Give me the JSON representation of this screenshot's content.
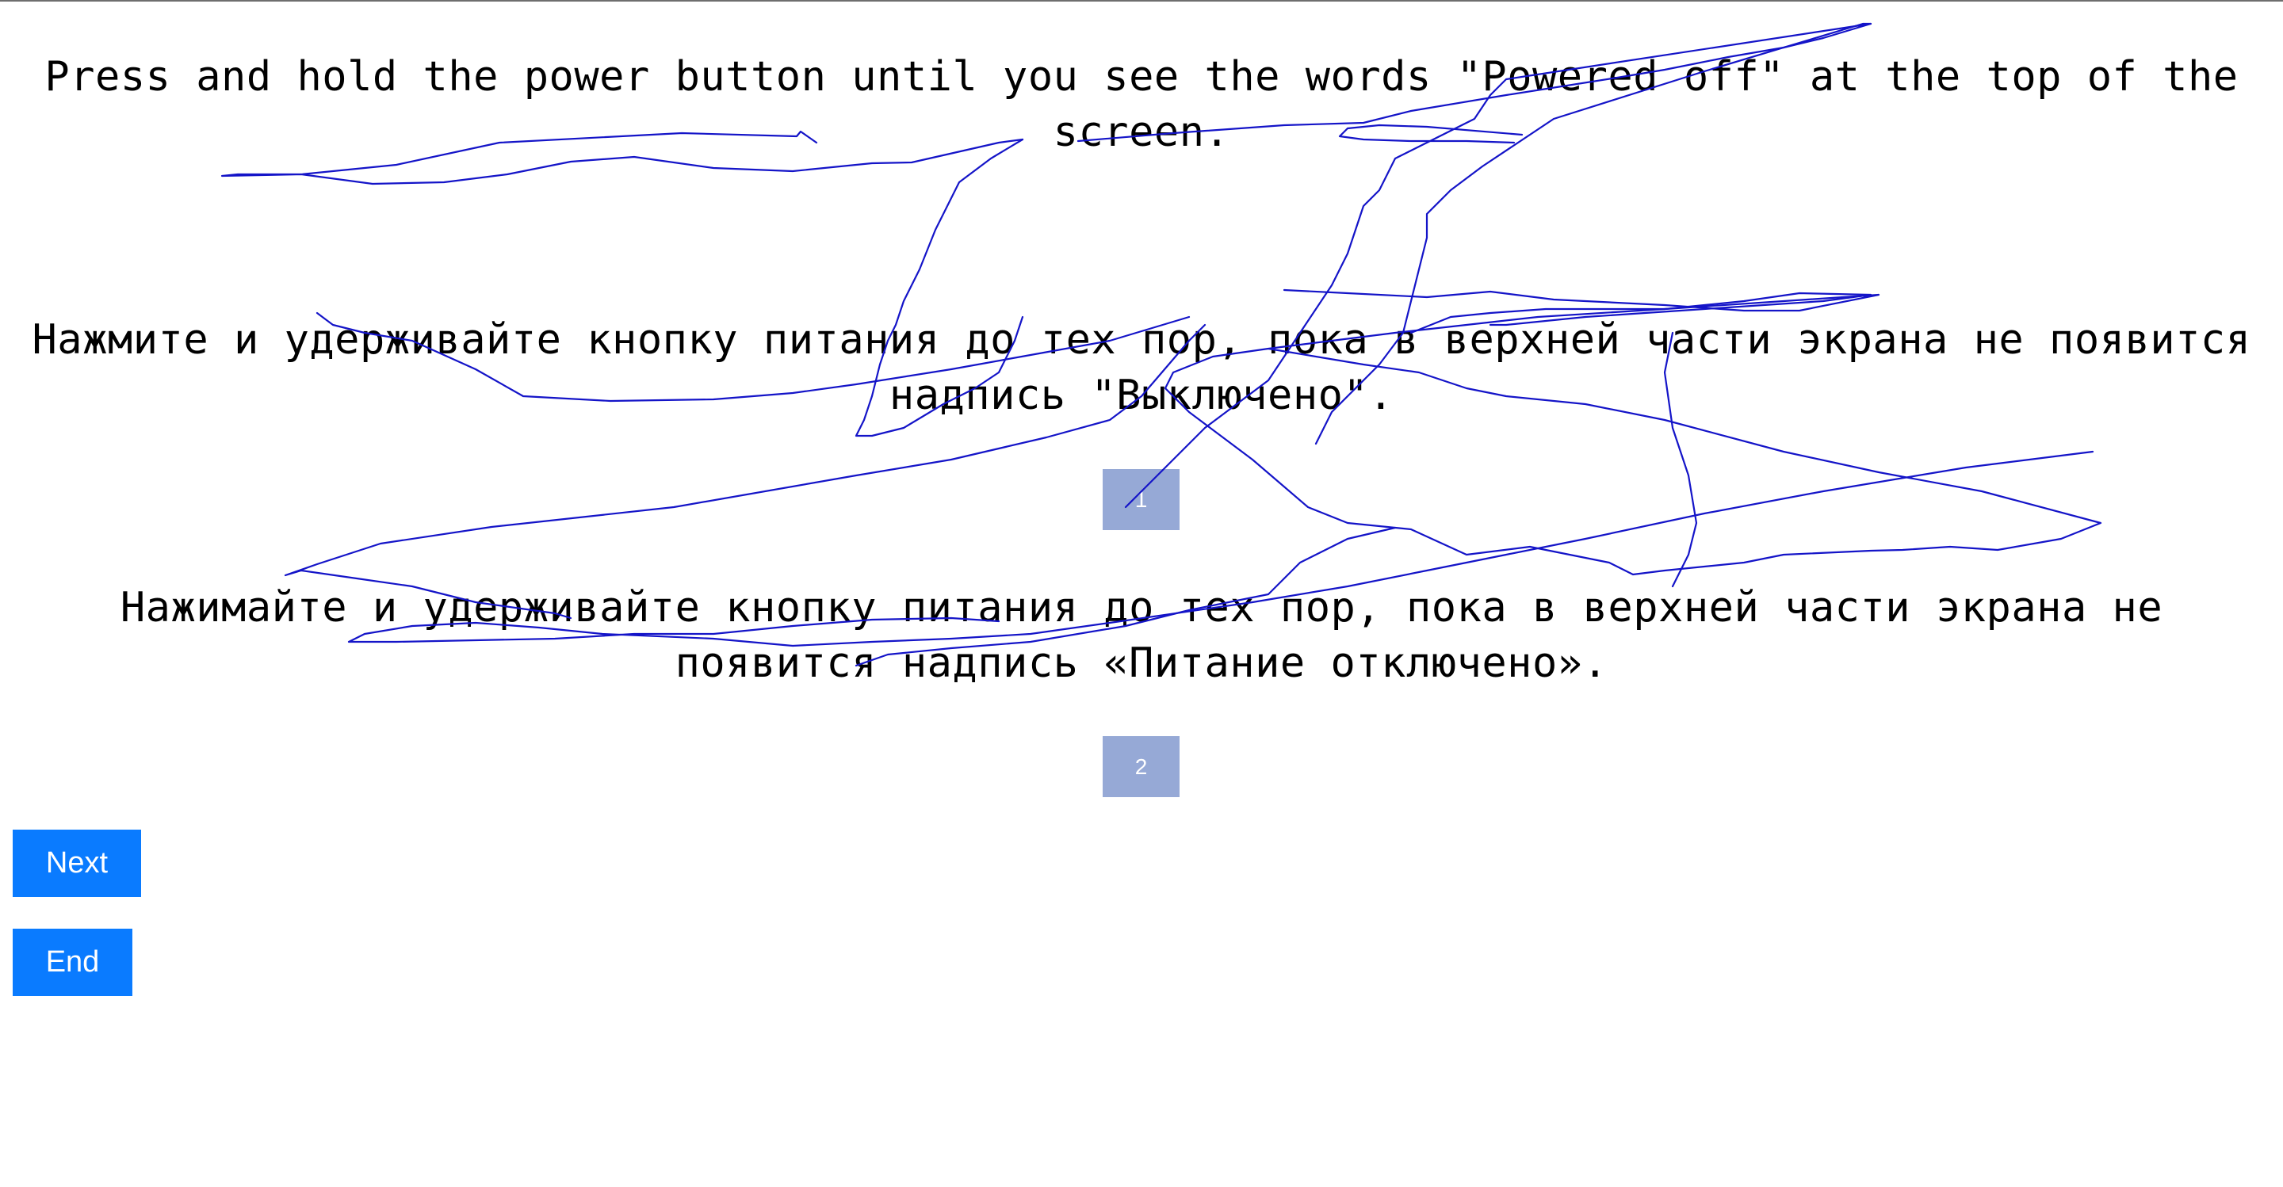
{
  "source_text": "Press and hold the power button until you see the words \"Powered off\" at the top of the screen.",
  "translations": [
    {
      "number": "1",
      "text": "Нажмите и удерживайте кнопку питания до тех пор, пока в верхней части экрана не появится надпись \"Выключено\"."
    },
    {
      "number": "2",
      "text": "Нажимайте и удерживайте кнопку питания до тех пор, пока в верхней части экрана не появится надпись «Питание отключено»."
    }
  ],
  "buttons": {
    "next_label": "Next",
    "end_label": "End"
  },
  "colors": {
    "choice_bg": "#96a9d6",
    "button_bg": "#0a7bff",
    "scribble": "#1414c8"
  }
}
